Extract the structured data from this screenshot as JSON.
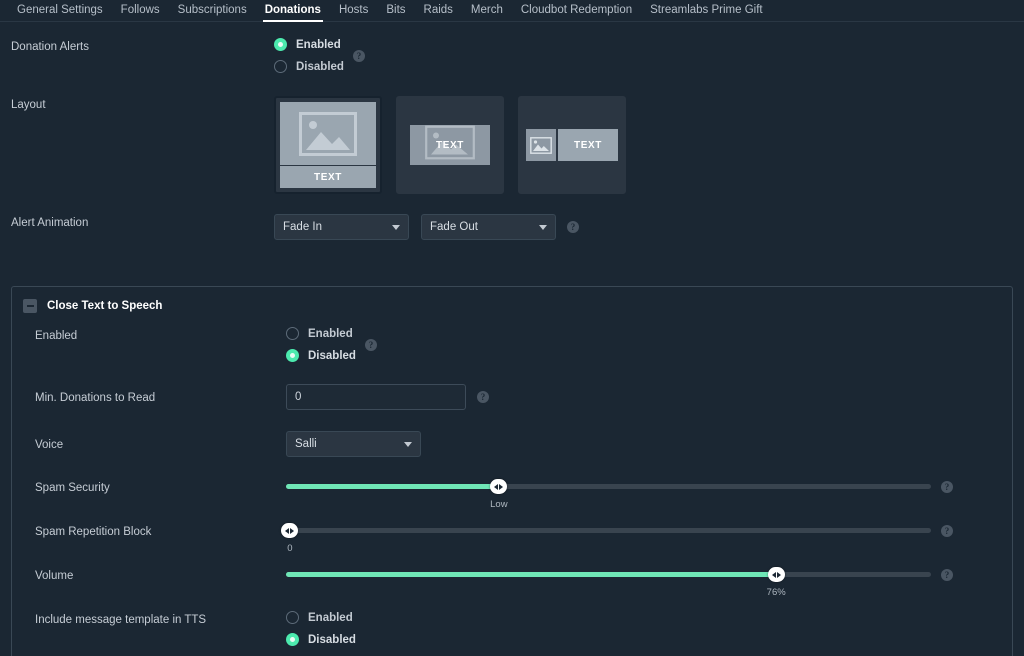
{
  "tabs": [
    {
      "label": "General Settings",
      "active": false
    },
    {
      "label": "Follows",
      "active": false
    },
    {
      "label": "Subscriptions",
      "active": false
    },
    {
      "label": "Donations",
      "active": true
    },
    {
      "label": "Hosts",
      "active": false
    },
    {
      "label": "Bits",
      "active": false
    },
    {
      "label": "Raids",
      "active": false
    },
    {
      "label": "Merch",
      "active": false
    },
    {
      "label": "Cloudbot Redemption",
      "active": false
    },
    {
      "label": "Streamlabs Prime Gift",
      "active": false
    }
  ],
  "colors": {
    "accent": "#4ceaae",
    "slider_fill": "#6fe6b6",
    "background": "#1b2733",
    "panel_border": "#3a4855",
    "text": "#c6cdd5"
  },
  "general": {
    "donation_alerts": {
      "label": "Donation Alerts",
      "enabled_label": "Enabled",
      "disabled_label": "Disabled",
      "selected": "Enabled",
      "help": "?"
    },
    "layout": {
      "label": "Layout",
      "cards": [
        {
          "name": "image-above-text",
          "text": "TEXT",
          "selected": true
        },
        {
          "name": "text-over-image",
          "text": "TEXT",
          "selected": false
        },
        {
          "name": "image-beside-text",
          "text": "TEXT",
          "selected": false
        }
      ]
    },
    "alert_animation": {
      "label": "Alert Animation",
      "in_value": "Fade In",
      "out_value": "Fade Out",
      "help": "?"
    }
  },
  "tts_panel": {
    "title": "Close Text to Speech",
    "enabled": {
      "label": "Enabled",
      "enabled_label": "Enabled",
      "disabled_label": "Disabled",
      "selected": "Disabled",
      "help": "?"
    },
    "min_donations": {
      "label": "Min. Donations to Read",
      "value": "0",
      "placeholder": "0",
      "help": "?"
    },
    "voice": {
      "label": "Voice",
      "value": "Salli"
    },
    "spam_security": {
      "label": "Spam Security",
      "value_label": "Low",
      "percent": 33,
      "help": "?"
    },
    "spam_repetition": {
      "label": "Spam Repetition Block",
      "value_label": "0",
      "percent": 0,
      "help": "?"
    },
    "volume": {
      "label": "Volume",
      "value_label": "76%",
      "percent": 76,
      "help": "?"
    },
    "include_template": {
      "label": "Include message template in TTS",
      "enabled_label": "Enabled",
      "disabled_label": "Disabled",
      "selected": "Disabled"
    }
  }
}
